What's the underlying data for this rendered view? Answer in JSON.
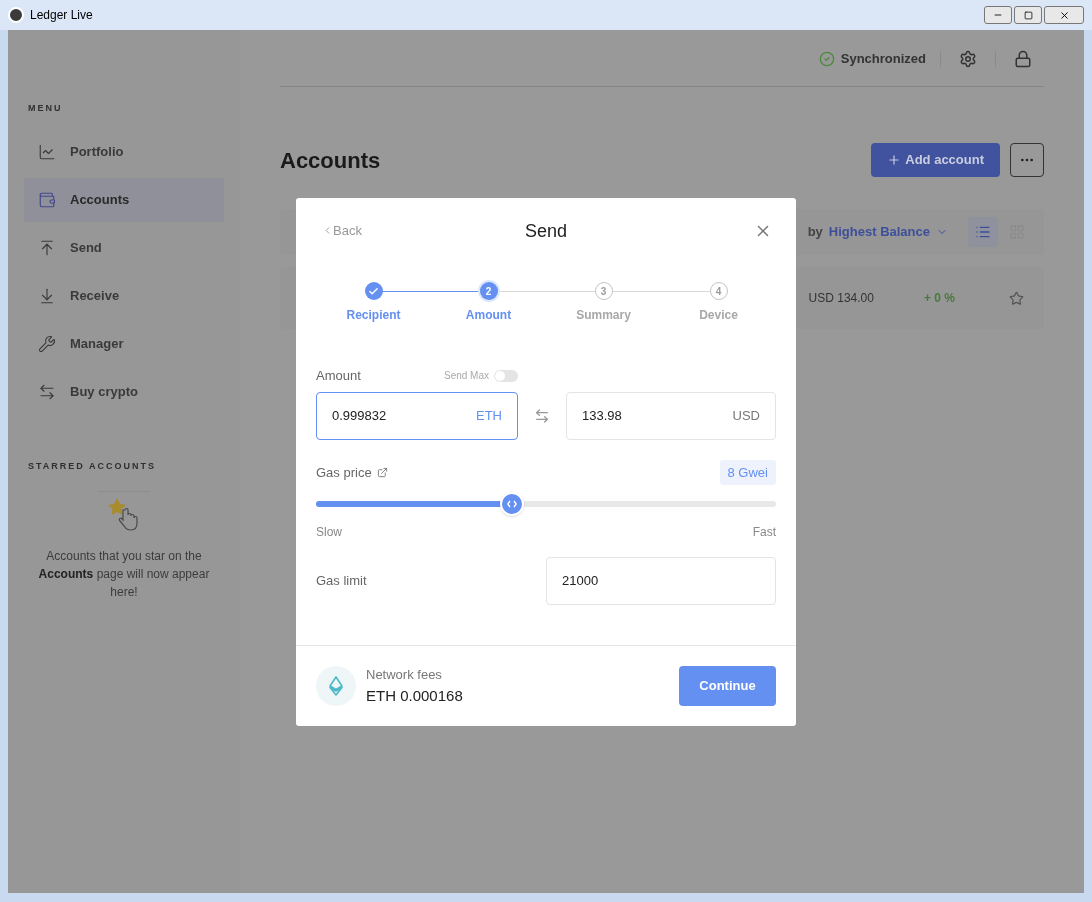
{
  "window": {
    "title": "Ledger Live"
  },
  "topbar": {
    "sync_status": "Synchronized"
  },
  "sidebar": {
    "menu_heading": "MENU",
    "items": [
      {
        "label": "Portfolio",
        "selected": false
      },
      {
        "label": "Accounts",
        "selected": true
      },
      {
        "label": "Send",
        "selected": false
      },
      {
        "label": "Receive",
        "selected": false
      },
      {
        "label": "Manager",
        "selected": false
      },
      {
        "label": "Buy crypto",
        "selected": false
      }
    ],
    "starred_heading": "STARRED ACCOUNTS",
    "starred_empty": "Accounts that you star on the **Accounts** page will now appear here!"
  },
  "page": {
    "title": "Accounts",
    "add_button": "Add account",
    "sort_prefix": "by",
    "sort_value": "Highest Balance",
    "view_modes": [
      {
        "kind": "list",
        "selected": true
      },
      {
        "kind": "grid",
        "selected": false
      }
    ],
    "account_row": {
      "balance": "USD 134.00",
      "change": "+ 0 %",
      "starred": false
    }
  },
  "modal": {
    "back": "Back",
    "title": "Send",
    "steps": [
      {
        "label": "Recipient",
        "completed": true,
        "selected": false
      },
      {
        "number": "2",
        "label": "Amount",
        "completed": false,
        "selected": true
      },
      {
        "number": "3",
        "label": "Summary",
        "completed": false,
        "selected": false
      },
      {
        "number": "4",
        "label": "Device",
        "completed": false,
        "selected": false
      }
    ],
    "amount_label": "Amount",
    "send_max_label": "Send Max",
    "send_max_on": false,
    "crypto_amount": "0.999832",
    "crypto_unit": "ETH",
    "fiat_amount": "133.98",
    "fiat_unit": "USD",
    "gas_price_label": "Gas price",
    "gas_price_value": "8 Gwei",
    "gas_slider": {
      "level": 0.426
    },
    "slow_label": "Slow",
    "fast_label": "Fast",
    "gas_limit_label": "Gas limit",
    "gas_limit_value": "21000",
    "fees_label": "Network fees",
    "fees_value": "ETH 0.000168",
    "continue_button": "Continue"
  }
}
